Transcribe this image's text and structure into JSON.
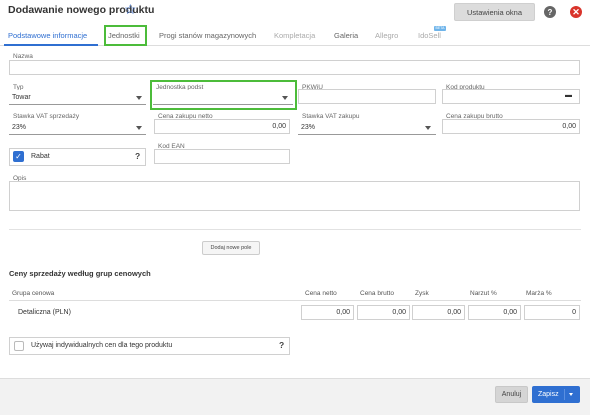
{
  "header": {
    "title": "Dodawanie nowego produktu",
    "settings_label": "Ustawienia okna",
    "help": "?",
    "close": "✕"
  },
  "tabs": [
    {
      "label": "Podstawowe informacje",
      "state": "active"
    },
    {
      "label": "Jednostki",
      "state": "normal"
    },
    {
      "label": "Progi stanów magazynowych",
      "state": "normal"
    },
    {
      "label": "Kompletacja",
      "state": "disabled"
    },
    {
      "label": "Galeria",
      "state": "normal"
    },
    {
      "label": "Allegro",
      "state": "disabled"
    },
    {
      "label": "IdoSell",
      "state": "disabled"
    }
  ],
  "form": {
    "nazwa_label": "Nazwa",
    "typ_label": "Typ",
    "typ_value": "Towar",
    "jednostka_label": "Jednostka podst",
    "jednostka_value": "",
    "pkwiu_label": "PKWiU",
    "kod_produktu_label": "Kod produktu",
    "vat_sprzedazy_label": "Stawka VAT sprzedaży",
    "vat_sprzedazy_value": "23%",
    "cena_zakupu_netto_label": "Cena zakupu netto",
    "cena_zakupu_netto_value": "0,00",
    "vat_zakupu_label": "Stawka VAT zakupu",
    "vat_zakupu_value": "23%",
    "cena_zakupu_brutto_label": "Cena zakupu brutto",
    "cena_zakupu_brutto_value": "0,00",
    "rabat_label": "Rabat",
    "kod_ean_label": "Kod EAN",
    "opis_label": "Opis",
    "add_field_label": "Dodaj nowe pole"
  },
  "prices": {
    "title": "Ceny sprzedaży według grup cenowych",
    "columns": [
      "Grupa cenowa",
      "Cena netto",
      "Cena brutto",
      "Zysk",
      "Narzut %",
      "Marża %"
    ],
    "rows": [
      {
        "name": "Detaliczna (PLN)",
        "values": [
          "0,00",
          "0,00",
          "0,00",
          "0,00",
          "0"
        ]
      }
    ],
    "individual_label": "Używaj indywidualnych cen dla tego produktu"
  },
  "footer": {
    "cancel_label": "Anuluj",
    "save_label": "Zapisz"
  },
  "colors": {
    "accent": "#2f6fd1",
    "highlight": "#4cbc3a",
    "close": "#d9342b"
  },
  "icons": [
    "star-icon",
    "help-icon",
    "close-icon",
    "folder-icon",
    "check-icon",
    "chevron-down-icon"
  ]
}
